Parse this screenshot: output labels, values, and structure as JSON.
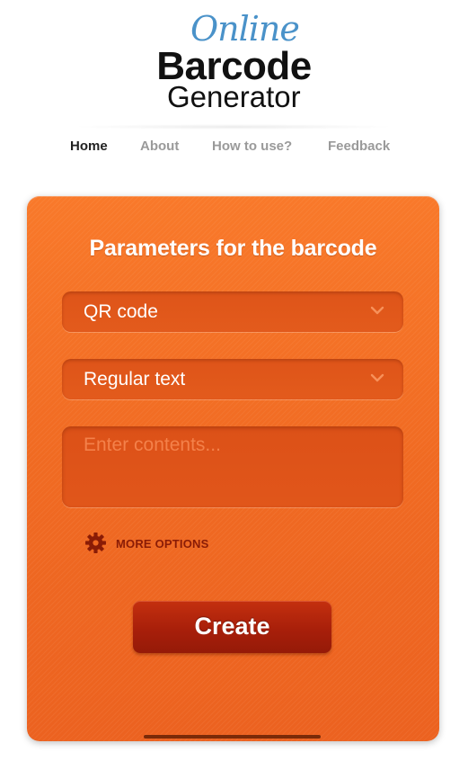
{
  "logo": {
    "line1": "Online",
    "line2": "Barcode",
    "line3": "Generator"
  },
  "nav": {
    "items": [
      {
        "label": "Home",
        "active": true
      },
      {
        "label": "About",
        "active": false
      },
      {
        "label": "How to use?",
        "active": false
      },
      {
        "label": "Feedback",
        "active": false
      }
    ]
  },
  "form": {
    "title": "Parameters for the barcode",
    "barcode_type": {
      "value": "QR code",
      "icon": "chevron-down-icon"
    },
    "content_type": {
      "value": "Regular text",
      "icon": "chevron-down-icon"
    },
    "contents": {
      "value": "",
      "placeholder": "Enter contents..."
    },
    "more_options": {
      "label": "MORE OPTIONS",
      "icon": "gear-icon"
    },
    "create_label": "Create"
  },
  "colors": {
    "panel": "#f26c22",
    "field": "#df5519",
    "button": "#a81f0a",
    "more_options_text": "#8a1c06",
    "logo_online": "#4a92c9",
    "nav_active": "#222222",
    "nav_inactive": "#9a9a9a"
  }
}
